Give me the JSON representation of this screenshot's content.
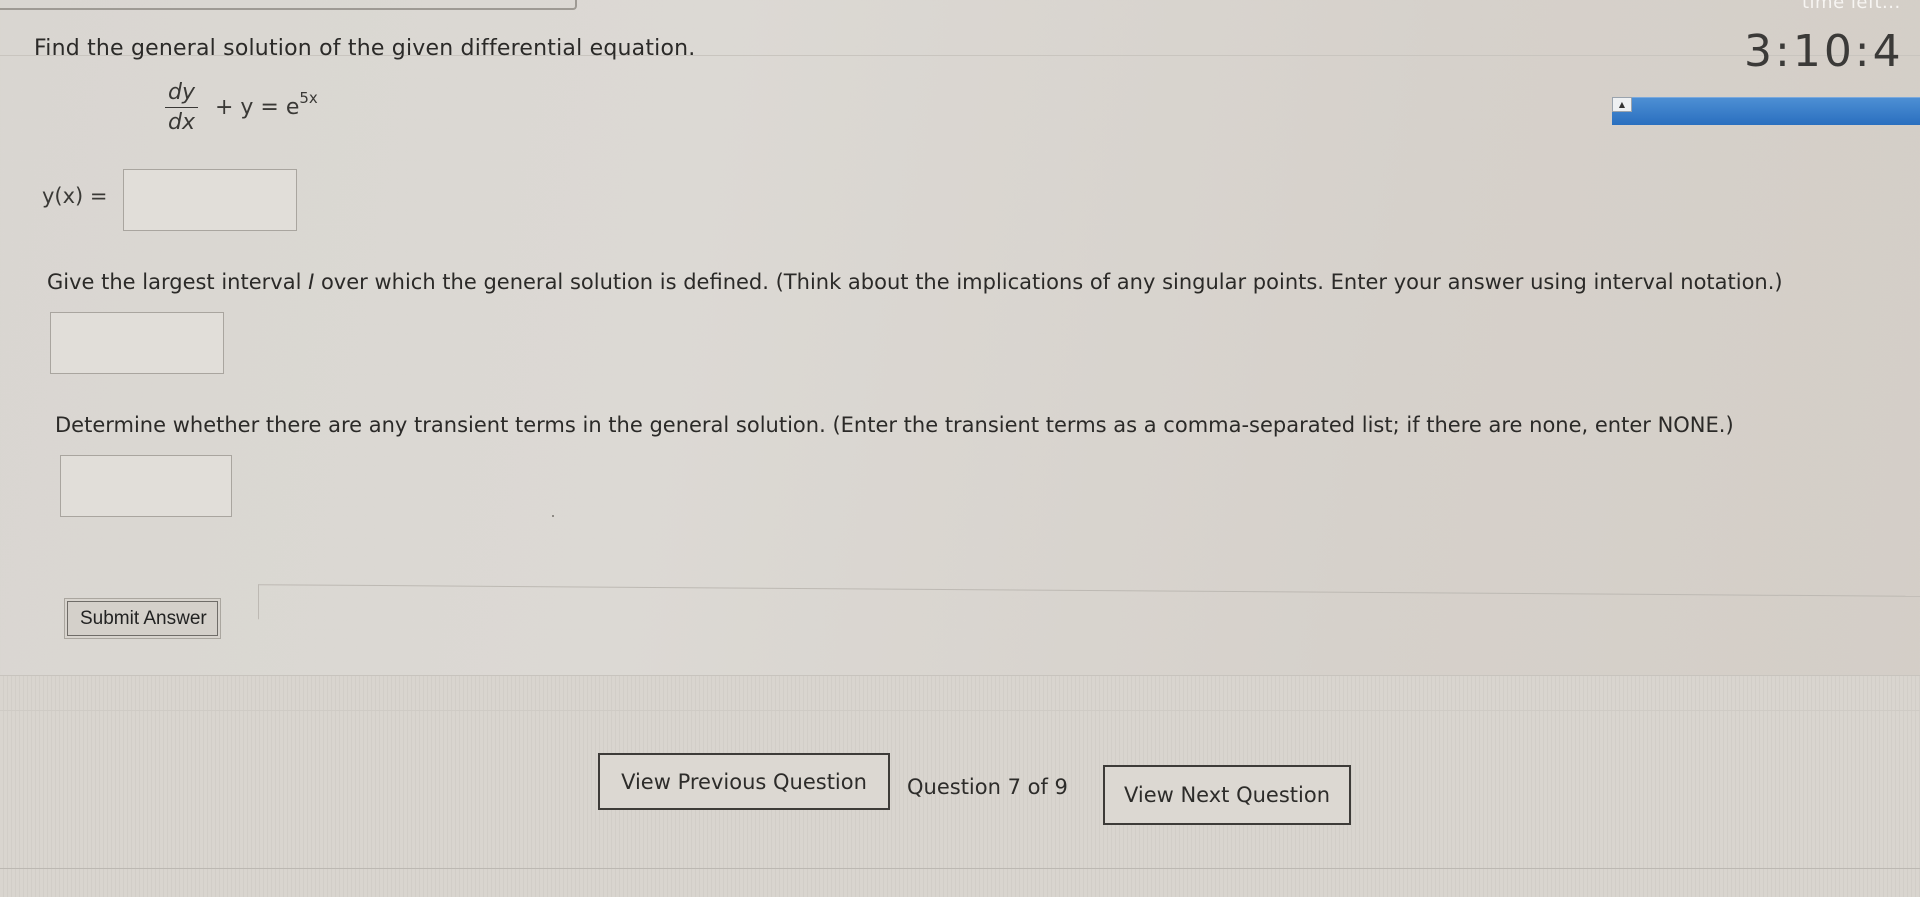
{
  "question": {
    "prompt": "Find the general solution of the given differential equation.",
    "equation": {
      "numerator": "dy",
      "denominator": "dx",
      "rest": " + y = e",
      "exponent": "5x"
    },
    "solution_label": "y(x) =",
    "solution_value": "",
    "interval_prompt_before": "Give the largest interval ",
    "interval_prompt_var": "I",
    "interval_prompt_after": " over which the general solution is defined. (Think about the implications of any singular points. Enter your answer using interval notation.)",
    "interval_value": "",
    "transient_prompt": "Determine whether there are any transient terms in the general solution. (Enter the transient terms as a comma-separated list; if there are none, enter NONE.)",
    "transient_value": ""
  },
  "submit": {
    "label": "Submit Answer"
  },
  "navigation": {
    "previous_label": "View Previous Question",
    "counter": "Question 7 of 9",
    "next_label": "View Next Question"
  },
  "timer": {
    "caption": "time left...",
    "value": "3:10:4",
    "toggle_icon": "collapse-up-icon",
    "bar_color": "#2a6fbf"
  }
}
